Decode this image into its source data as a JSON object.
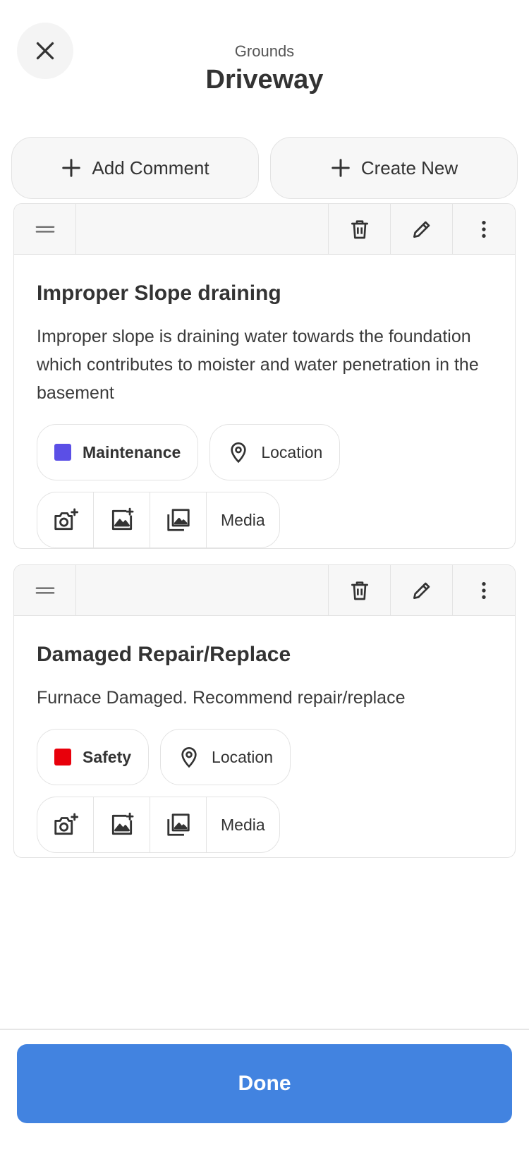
{
  "header": {
    "subtitle": "Grounds",
    "title": "Driveway"
  },
  "actions": {
    "add_comment": "Add Comment",
    "create_new": "Create New"
  },
  "comments": [
    {
      "title": "Improper Slope draining",
      "description": "Improper slope is draining water towards the foundation which contributes to moister and water penetration in the basement",
      "category": "Maintenance",
      "category_color": "#5b4fe6",
      "location_label": "Location",
      "media_label": "Media"
    },
    {
      "title": "Damaged Repair/Replace",
      "description": "Furnace Damaged. Recommend repair/replace",
      "category": "Safety",
      "category_color": "#e8000b",
      "location_label": "Location",
      "media_label": "Media"
    }
  ],
  "footer": {
    "done_label": "Done"
  },
  "colors": {
    "primary": "#4283e0",
    "border": "#e3e3e3",
    "toolbar_bg": "#f7f7f7"
  }
}
